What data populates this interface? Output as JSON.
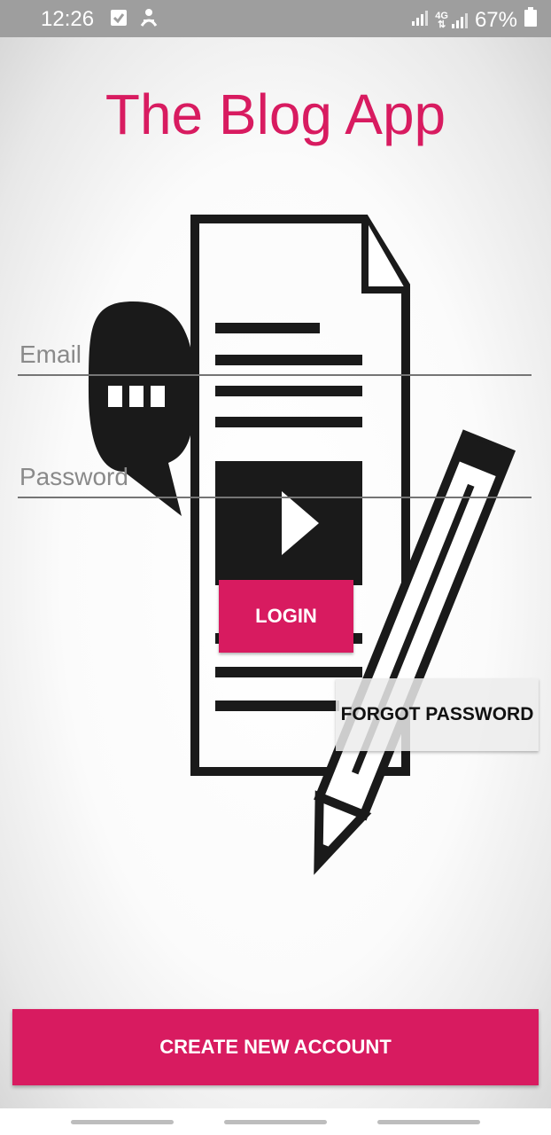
{
  "status_bar": {
    "time": "12:26",
    "network": "4G",
    "battery": "67%",
    "icons": [
      "checkbox-notification-icon",
      "sync-notification-icon",
      "signal-icon",
      "signal-4g-icon",
      "battery-icon"
    ]
  },
  "app": {
    "title": "The Blog App",
    "title_color": "#d81b60"
  },
  "form": {
    "email_placeholder": "Email",
    "password_placeholder": "Password",
    "login_label": "LOGIN",
    "forgot_label": "FORGOT PASSWORD",
    "create_label": "CREATE NEW ACCOUNT"
  },
  "colors": {
    "accent": "#d81b60",
    "status_bar": "#9e9e9e"
  }
}
